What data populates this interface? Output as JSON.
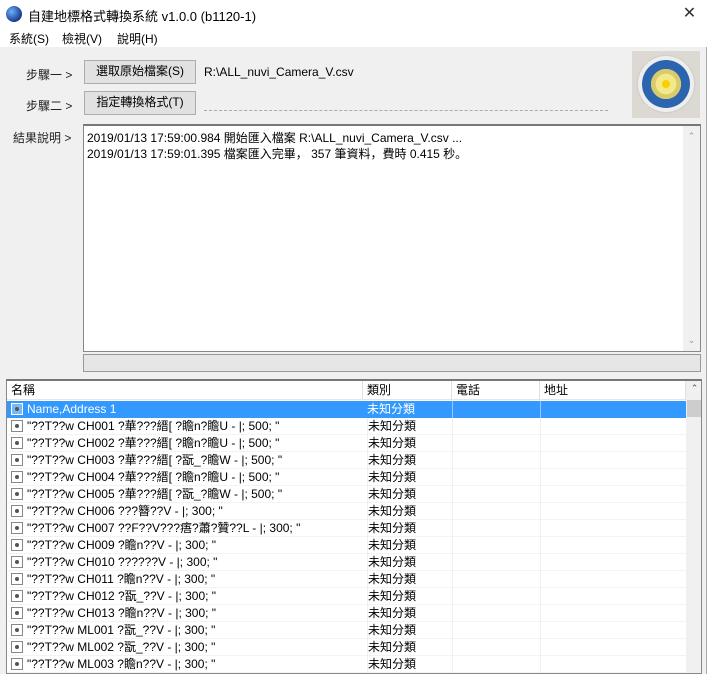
{
  "window": {
    "title": "自建地標格式轉換系統 v1.0.0 (b1120-1)",
    "close": "✕"
  },
  "menu": [
    "系統(S)",
    "檢視(V)",
    "說明(H)"
  ],
  "step1": {
    "label": "步驟一 >",
    "button": "選取原始檔案(S)",
    "path": "R:\\ALL_nuvi_Camera_V.csv"
  },
  "step2": {
    "label": "步驟二 >",
    "button": "指定轉換格式(T)"
  },
  "result": {
    "label": "結果說明 >",
    "lines": [
      "2019/01/13 17:59:00.984  開始匯入檔案 R:\\ALL_nuvi_Camera_V.csv ...",
      "2019/01/13 17:59:01.395  檔案匯入完畢， 357 筆資料，費時 0.415 秒。"
    ]
  },
  "table": {
    "columns": [
      "名稱",
      "類別",
      "電話",
      "地址"
    ],
    "rows": [
      {
        "name": "Name,Address 1",
        "category": "未知分類",
        "selected": true
      },
      {
        "name": "\"??T??w CH001 ?華???縉[ ?瞻n?瞻U - |; 500; \"",
        "category": "未知分類"
      },
      {
        "name": "\"??T??w CH002 ?華???縉[ ?瞻n?瞻U - |; 500; \"",
        "category": "未知分類"
      },
      {
        "name": "\"??T??w CH003 ?華???縉[ ?翫_?瞻W - |; 500; \"",
        "category": "未知分類"
      },
      {
        "name": "\"??T??w CH004 ?華???縉[ ?瞻n?瞻U - |; 500; \"",
        "category": "未知分類"
      },
      {
        "name": "\"??T??w CH005 ?華???縉[ ?翫_?瞻W - |; 500; \"",
        "category": "未知分類"
      },
      {
        "name": "\"??T??w CH006 ???簪??V - |; 300; \"",
        "category": "未知分類"
      },
      {
        "name": "\"??T??w CH007 ??F??V???痦?蕭?贊??L - |; 300; \"",
        "category": "未知分類"
      },
      {
        "name": "\"??T??w CH009 ?瞻n??V - |; 300; \"",
        "category": "未知分類"
      },
      {
        "name": "\"??T??w CH010 ??????V - |; 300; \"",
        "category": "未知分類"
      },
      {
        "name": "\"??T??w CH011 ?瞻n??V - |; 300; \"",
        "category": "未知分類"
      },
      {
        "name": "\"??T??w CH012 ?翫_??V - |; 300; \"",
        "category": "未知分類"
      },
      {
        "name": "\"??T??w CH013 ?瞻n??V - |; 300; \"",
        "category": "未知分類"
      },
      {
        "name": "\"??T??w ML001 ?翫_??V - |; 300; \"",
        "category": "未知分類"
      },
      {
        "name": "\"??T??w ML002 ?翫_??V - |; 300; \"",
        "category": "未知分類"
      },
      {
        "name": "\"??T??w ML003 ?瞻n??V - |; 300; \"",
        "category": "未知分類"
      }
    ]
  }
}
